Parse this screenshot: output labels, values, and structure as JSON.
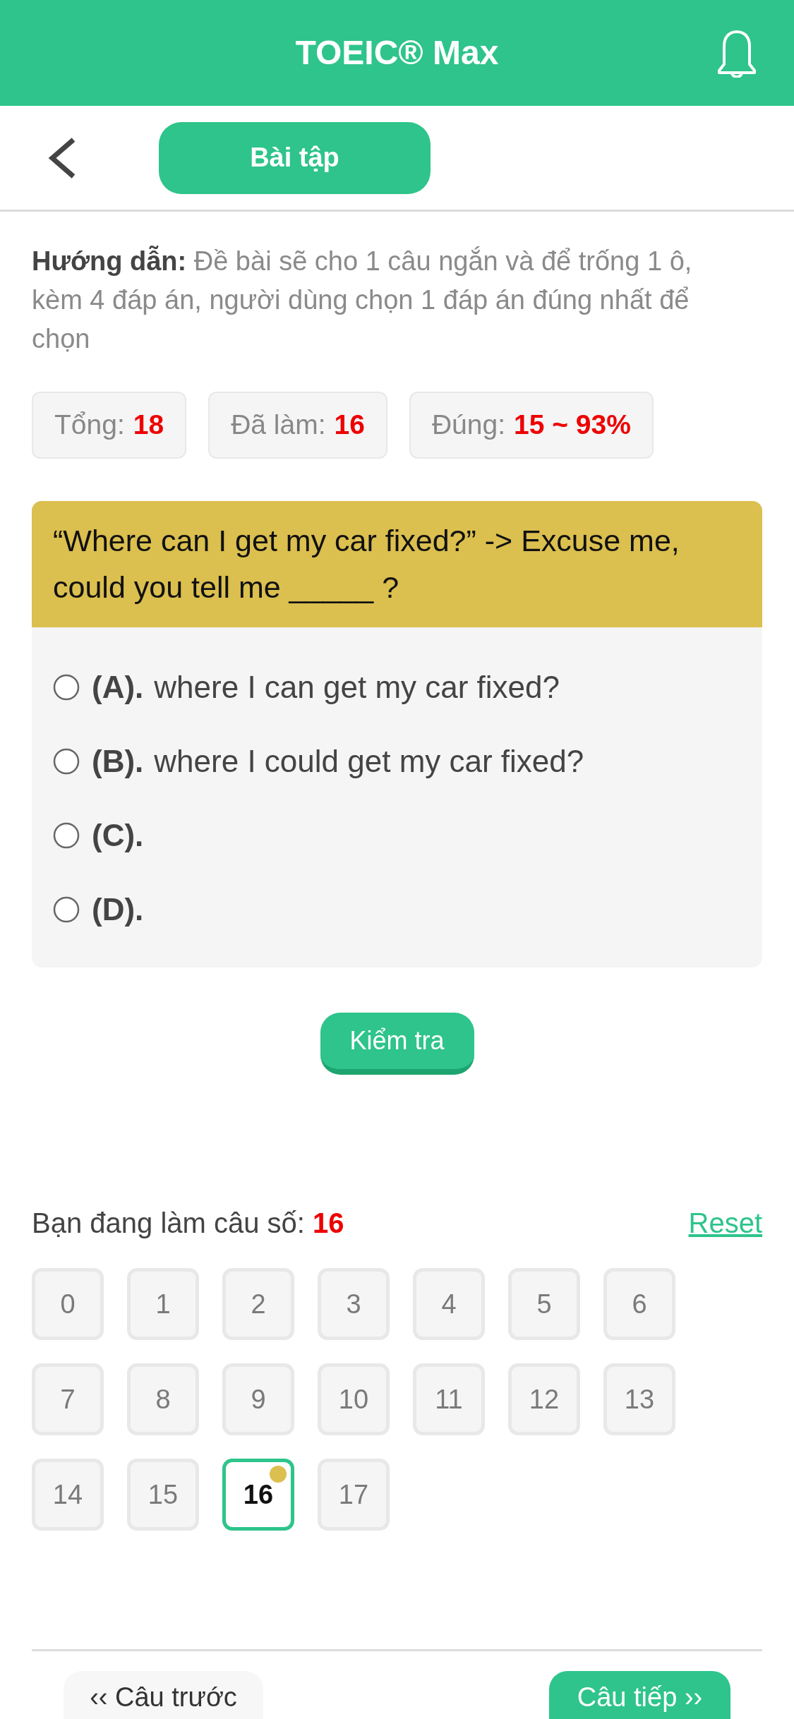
{
  "header": {
    "title": "TOEIC® Max"
  },
  "nav": {
    "section_label": "Bài tập"
  },
  "instructions": {
    "text": "**Hướng dẫn:** Đề bài sẽ cho 1 câu ngắn và để trống 1 ô, kèm 4 đáp án, người dùng chọn 1 đáp án đúng nhất để chọn"
  },
  "stats": [
    {
      "label": "Tổng:",
      "value": "18"
    },
    {
      "label": "Đã làm:",
      "value": "16"
    },
    {
      "label": "Đúng:",
      "value": "15 ~ 93%"
    }
  ],
  "question": {
    "text": "“Where can I get my car fixed?” -> Excuse me, could you tell me _____ ?",
    "options": [
      {
        "letter": "(A).",
        "text": "where I can get my car fixed?",
        "selected": false
      },
      {
        "letter": "(B).",
        "text": "where I could get my car fixed?",
        "selected": false
      },
      {
        "letter": "(C).",
        "selected": false
      },
      {
        "letter": "(D).",
        "selected": false
      }
    ]
  },
  "check_button": {
    "label": "Kiểm tra"
  },
  "progress": {
    "label": "Bạn đang làm câu số:",
    "current": "16",
    "reset": "Reset"
  },
  "question_grid": [
    {
      "number": "0",
      "selected": false,
      "marked": false
    },
    {
      "number": "1",
      "selected": false,
      "marked": false
    },
    {
      "number": "2",
      "selected": false,
      "marked": false
    },
    {
      "number": "3",
      "selected": false,
      "marked": false
    },
    {
      "number": "4",
      "selected": false,
      "marked": false
    },
    {
      "number": "5",
      "selected": false,
      "marked": false
    },
    {
      "number": "6",
      "selected": false,
      "marked": false
    },
    {
      "number": "7",
      "selected": false,
      "marked": false
    },
    {
      "number": "8",
      "selected": false,
      "marked": false
    },
    {
      "number": "9",
      "selected": false,
      "marked": false
    },
    {
      "number": "10",
      "selected": false,
      "marked": false
    },
    {
      "number": "11",
      "selected": false,
      "marked": false
    },
    {
      "number": "12",
      "selected": false,
      "marked": false
    },
    {
      "number": "13",
      "selected": false,
      "marked": false
    },
    {
      "number": "14",
      "selected": false,
      "marked": false
    },
    {
      "number": "15",
      "selected": false,
      "marked": false
    },
    {
      "number": "16",
      "selected": true,
      "marked": true
    },
    {
      "number": "17",
      "selected": false,
      "marked": false
    }
  ],
  "footer": {
    "previous": "‹‹ Câu trước",
    "next": "Câu tiếp ››"
  }
}
